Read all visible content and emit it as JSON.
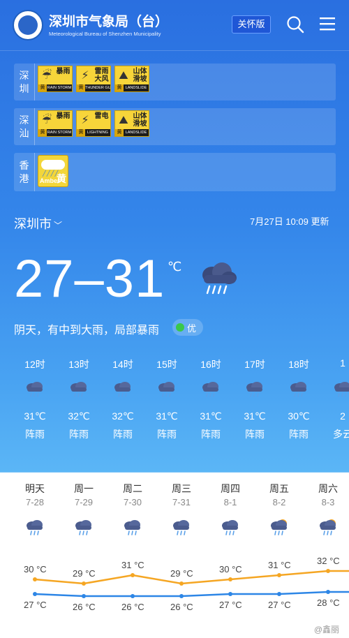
{
  "header": {
    "title_cn": "深圳市气象局（台）",
    "title_en": "Meteorological Bureau of Shenzhen Municipality",
    "care_button": "关怀版"
  },
  "warnings": [
    {
      "city_lines": [
        "深",
        "圳"
      ],
      "badges": [
        {
          "text": "暴雨",
          "color": "黄",
          "name": "RAIN STORM",
          "icon": "rain-icon"
        },
        {
          "text": "雷雨大风",
          "color": "黄",
          "name": "THUNDER GUST",
          "icon": "thunder-gust-icon"
        },
        {
          "text": "山体滑坡",
          "color": "黄",
          "name": "LANDSLIDE",
          "icon": "landslide-icon"
        }
      ]
    },
    {
      "city_lines": [
        "深",
        "汕"
      ],
      "badges": [
        {
          "text": "暴雨",
          "color": "黄",
          "name": "RAIN STORM",
          "icon": "rain-icon"
        },
        {
          "text": "雷电",
          "color": "黄",
          "name": "LIGHTNING",
          "icon": "lightning-icon"
        },
        {
          "text": "山体滑坡",
          "color": "黄",
          "name": "LANDSLIDE",
          "icon": "landslide-icon"
        }
      ]
    },
    {
      "city_lines": [
        "香",
        "港"
      ],
      "amber": {
        "label_en": "Amber",
        "label_cn": "黄"
      }
    }
  ],
  "current": {
    "city": "深圳市",
    "update": "7月27日 10:09 更新",
    "temp": "27–31",
    "unit": "℃",
    "desc": "阴天，有中到大雨，局部暴雨",
    "aqi": "优"
  },
  "hourly": [
    {
      "time": "12时",
      "temp": "31℃",
      "desc": "阵雨"
    },
    {
      "time": "13时",
      "temp": "32℃",
      "desc": "阵雨"
    },
    {
      "time": "14时",
      "temp": "32℃",
      "desc": "阵雨"
    },
    {
      "time": "15时",
      "temp": "31℃",
      "desc": "阵雨"
    },
    {
      "time": "16时",
      "temp": "31℃",
      "desc": "阵雨"
    },
    {
      "time": "17时",
      "temp": "31℃",
      "desc": "阵雨"
    },
    {
      "time": "18时",
      "temp": "30℃",
      "desc": "阵雨"
    },
    {
      "time": "1",
      "temp": "2",
      "desc": "多云"
    }
  ],
  "daily": [
    {
      "day": "明天",
      "date": "7-28",
      "high": "30 °C",
      "low": "27 °C",
      "icon": "rain-cloud-icon"
    },
    {
      "day": "周一",
      "date": "7-29",
      "high": "29 °C",
      "low": "26 °C",
      "icon": "rain-cloud-icon"
    },
    {
      "day": "周二",
      "date": "7-30",
      "high": "31 °C",
      "low": "26 °C",
      "icon": "rain-cloud-icon"
    },
    {
      "day": "周三",
      "date": "7-31",
      "high": "29 °C",
      "low": "26 °C",
      "icon": "rain-cloud-icon"
    },
    {
      "day": "周四",
      "date": "8-1",
      "high": "30 °C",
      "low": "27 °C",
      "icon": "rain-cloud-icon"
    },
    {
      "day": "周五",
      "date": "8-2",
      "high": "31 °C",
      "low": "27 °C",
      "icon": "sun-cloud-rain-icon"
    },
    {
      "day": "周六",
      "date": "8-3",
      "high": "32 °C",
      "low": "28 °C",
      "icon": "sun-cloud-rain-icon"
    }
  ],
  "trend": {
    "high_values": [
      30,
      29,
      31,
      29,
      30,
      31,
      32
    ],
    "low_values": [
      27,
      26,
      26,
      26,
      27,
      27,
      28
    ],
    "high_color": "#f5a623",
    "low_color": "#2d86e6"
  },
  "watermark": "@鑫丽"
}
